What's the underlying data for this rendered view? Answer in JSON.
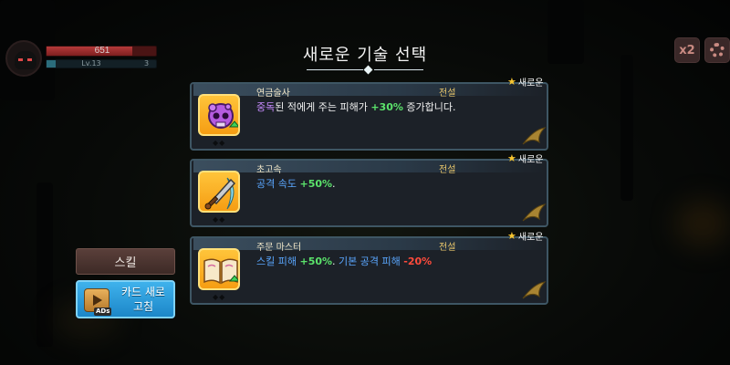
{
  "hud": {
    "hp_value": "651",
    "level": "Lv.13",
    "xp_value": "3",
    "speed_label": "x2"
  },
  "title": "새로운 기술 선택",
  "cards": [
    {
      "name": "연금술사",
      "grade": "전설",
      "new_label": "새로운",
      "icon": "poison-skull-icon",
      "desc_parts": [
        {
          "text": "중독",
          "style": "purple"
        },
        {
          "text": "된 적에게 주는 피해가 ",
          "style": "white"
        },
        {
          "text": "+30%",
          "style": "green"
        },
        {
          "text": " 증가합니다.",
          "style": "white"
        }
      ]
    },
    {
      "name": "초고속",
      "grade": "전설",
      "new_label": "새로운",
      "icon": "sword-slash-icon",
      "desc_parts": [
        {
          "text": "공격 속도 ",
          "style": "blue"
        },
        {
          "text": " +50%",
          "style": "green"
        },
        {
          "text": ".",
          "style": "white"
        }
      ]
    },
    {
      "name": "주문 마스터",
      "grade": "전설",
      "new_label": "새로운",
      "icon": "spellbook-icon",
      "desc_parts": [
        {
          "text": "스킬 피해 ",
          "style": "blue"
        },
        {
          "text": "+50%",
          "style": "green"
        },
        {
          "text": ". ",
          "style": "white"
        },
        {
          "text": "기본 공격 피해 ",
          "style": "blue"
        },
        {
          "text": "-20%",
          "style": "red"
        }
      ]
    }
  ],
  "buttons": {
    "skill_label": "스킬",
    "refresh_label_line1": "카드 새로",
    "refresh_label_line2": "고침",
    "ads_label": "ADs"
  },
  "colors": {
    "accent_green": "#5be36b",
    "accent_red": "#ff4b3c",
    "accent_blue": "#5aa7ff",
    "accent_purple": "#c78bff",
    "icon_bg": "#f59d13",
    "grade_gold": "#e6c46a",
    "refresh_button": "#1c86c8",
    "skill_button": "#4a332e"
  }
}
